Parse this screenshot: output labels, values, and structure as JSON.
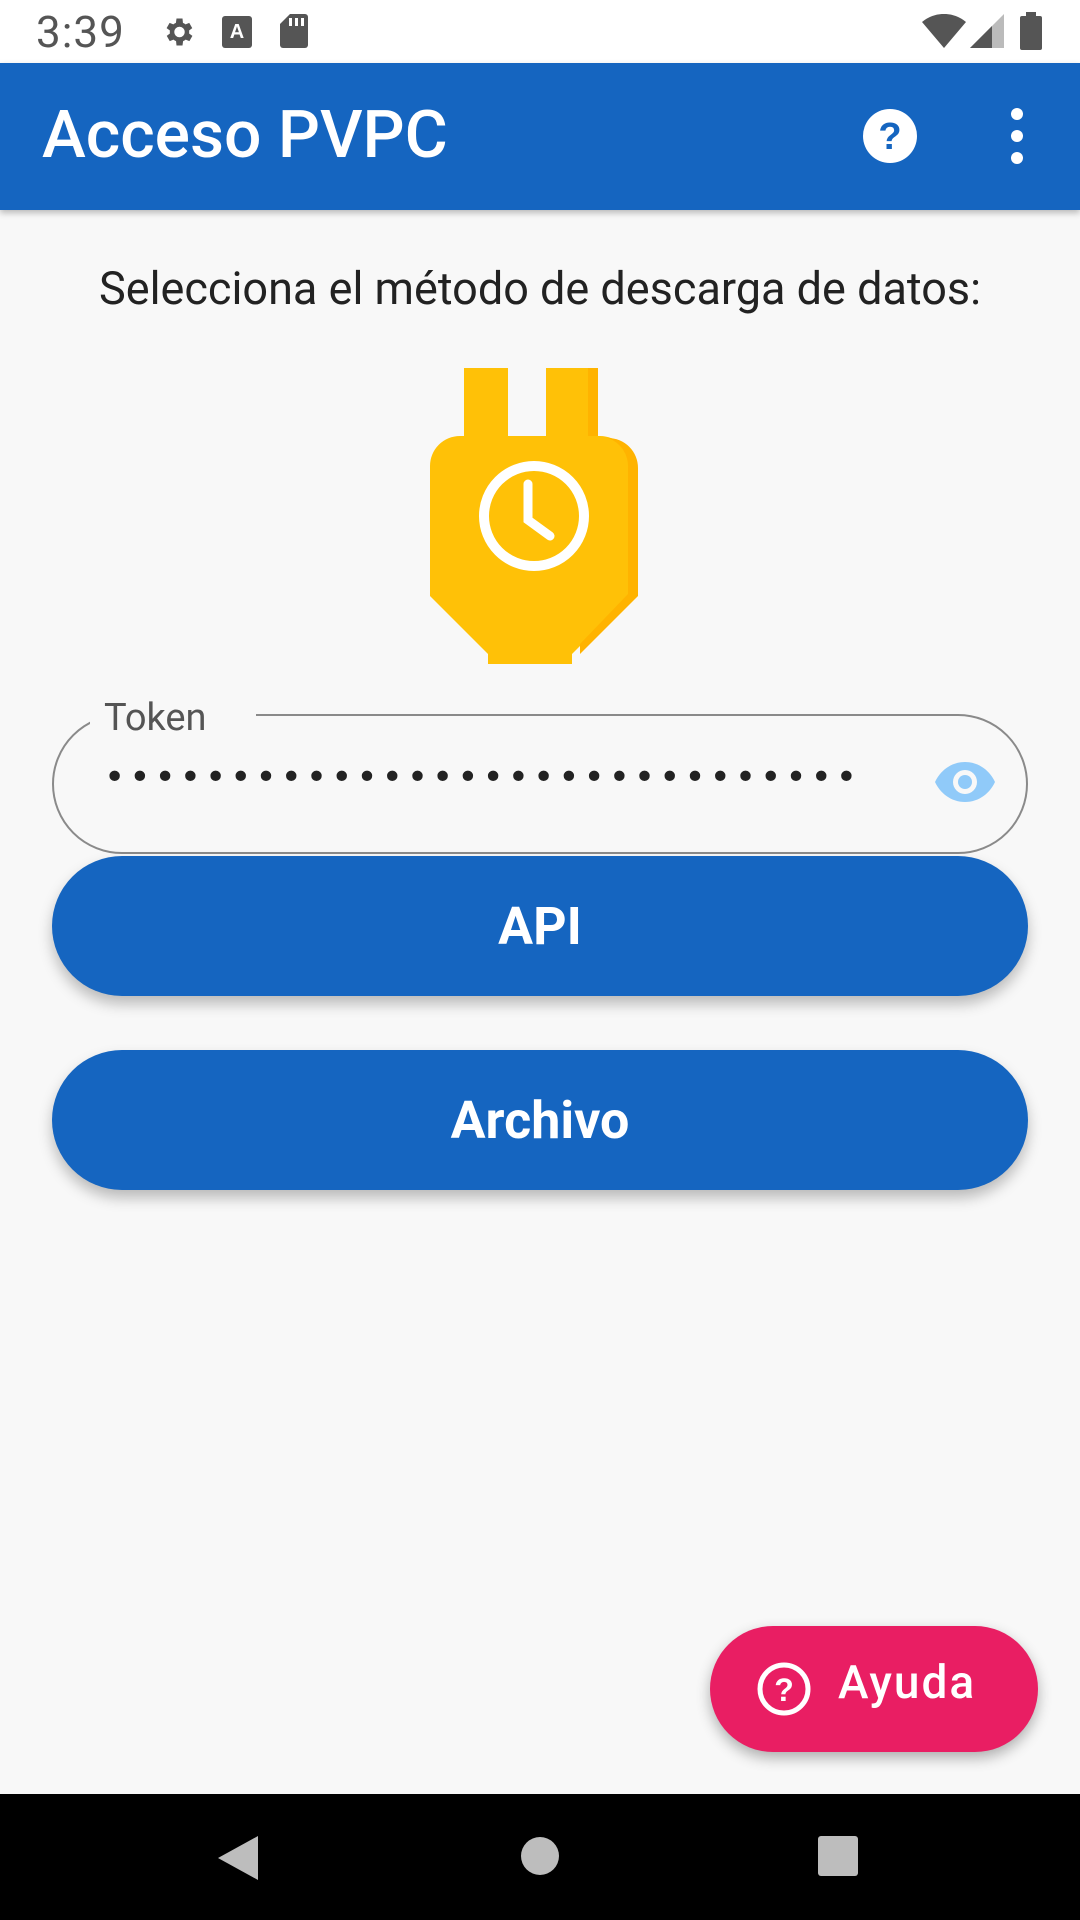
{
  "status_bar": {
    "time": "3:39",
    "icons": [
      "settings-icon",
      "a-notification-icon",
      "sd-card-icon",
      "wifi-icon",
      "cell-signal-icon",
      "battery-icon"
    ]
  },
  "app_bar": {
    "title": "Acceso PVPC",
    "actions": [
      "help-icon",
      "more-vert-icon"
    ],
    "color": "#1565c0"
  },
  "main": {
    "prompt": "Selecciona el método de descarga de datos:",
    "logo_icon": "plug-clock-icon",
    "logo_color": "#ffc107",
    "token": {
      "label": "Token",
      "value": "••••••••••••••••••••••••••••••••••••••",
      "toggle_icon": "eye-icon"
    },
    "buttons": {
      "api": "API",
      "file": "Archivo"
    }
  },
  "fab": {
    "label": "Ayuda",
    "icon": "help-circle-icon",
    "color": "#e91e63"
  },
  "nav_bar": {
    "buttons": [
      "back-icon",
      "home-icon",
      "recents-icon"
    ]
  }
}
